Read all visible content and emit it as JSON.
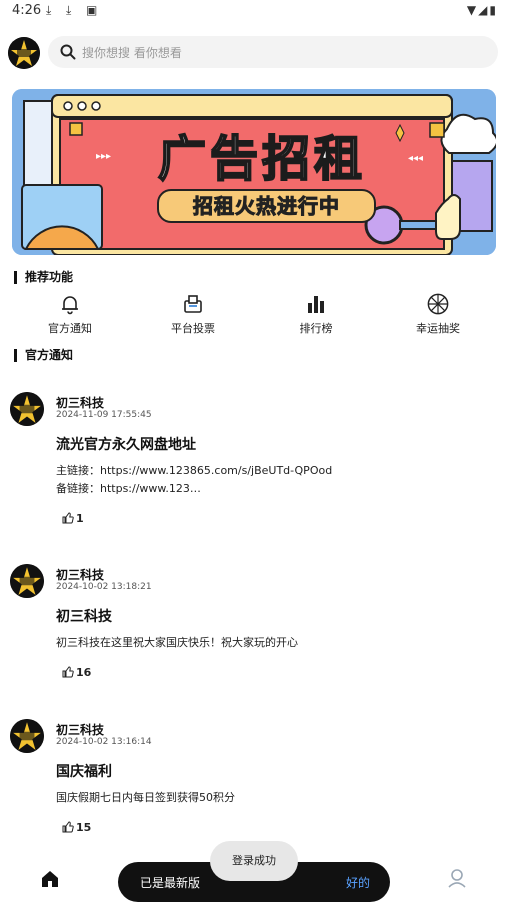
{
  "status_bar": {
    "time": "4:26"
  },
  "search": {
    "placeholder": "搜你想搜 看你想看"
  },
  "banner": {
    "title": "广告招租",
    "subtitle": "招租火热进行中"
  },
  "sections": {
    "recommended": "推荐功能",
    "official": "官方通知"
  },
  "features": [
    {
      "label": "官方通知",
      "icon": "bell-icon"
    },
    {
      "label": "平台投票",
      "icon": "vote-icon"
    },
    {
      "label": "排行榜",
      "icon": "bar-chart-icon"
    },
    {
      "label": "幸运抽奖",
      "icon": "wheel-icon"
    }
  ],
  "posts": [
    {
      "author": "初三科技",
      "date": "2024-11-09 17:55:45",
      "title": "流光官方永久网盘地址",
      "lines": [
        "主链接：https://www.123865.com/s/jBeUTd-QPOod",
        "备链接：https://www.123…"
      ],
      "likes": "1"
    },
    {
      "author": "初三科技",
      "date": "2024-10-02 13:18:21",
      "title": "初三科技",
      "lines": [
        "初三科技在这里祝大家国庆快乐！祝大家玩的开心"
      ],
      "likes": "16"
    },
    {
      "author": "初三科技",
      "date": "2024-10-02 13:16:14",
      "title": "国庆福利",
      "lines": [
        "国庆假期七日内每日签到获得50积分"
      ],
      "likes": "15"
    }
  ],
  "snackbar": {
    "message": "已是最新版",
    "action": "好的"
  },
  "toast": {
    "message": "登录成功"
  },
  "colors": {
    "banner_bg": "#7fb2e8",
    "banner_panel": "#f26b6b",
    "snackbar_action": "#5aa2ff"
  }
}
